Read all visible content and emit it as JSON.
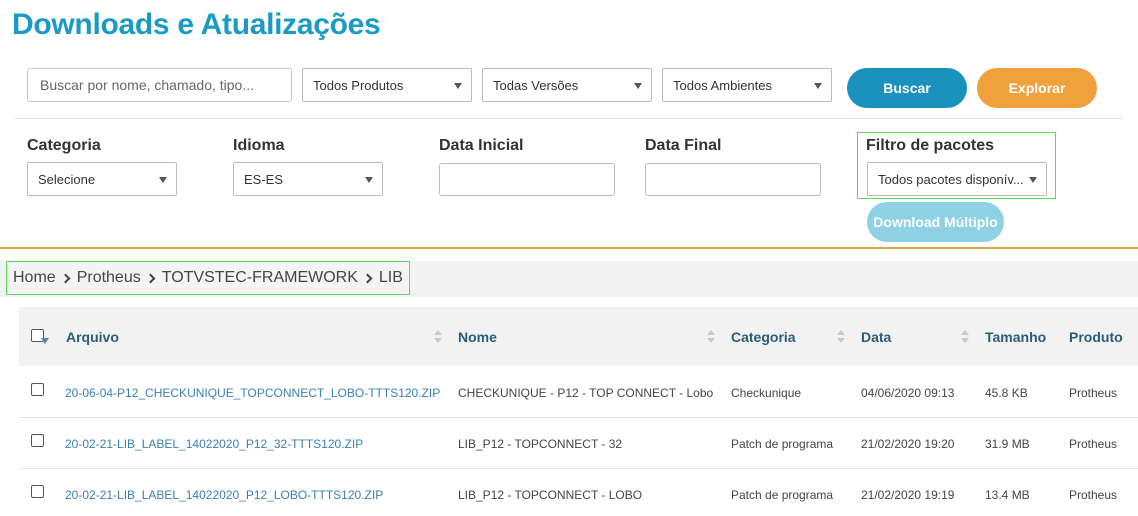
{
  "page": {
    "title": "Downloads e Atualizações"
  },
  "search": {
    "placeholder": "Buscar por nome, chamado, tipo..."
  },
  "filters": {
    "produto": "Todos Produtos",
    "versao": "Todas Versões",
    "ambiente": "Todos Ambientes",
    "buscar_label": "Buscar",
    "explorar_label": "Explorar",
    "categoria": {
      "label": "Categoria",
      "value": "Selecione"
    },
    "idioma": {
      "label": "Idioma",
      "value": "ES-ES"
    },
    "data_inicial": {
      "label": "Data Inicial"
    },
    "data_final": {
      "label": "Data Final"
    },
    "filtro_pacotes": {
      "label": "Filtro de pacotes",
      "value": "Todos pacotes disponív..."
    },
    "download_multiplo_label": "Download Múltiplo"
  },
  "breadcrumb": [
    "Home",
    "Protheus",
    "TOTVSTEC-FRAMEWORK",
    "LIB"
  ],
  "table": {
    "headers": {
      "arquivo": "Arquivo",
      "nome": "Nome",
      "categoria": "Categoria",
      "data": "Data",
      "tamanho": "Tamanho",
      "produto": "Produto"
    },
    "rows": [
      {
        "arquivo": "20-06-04-P12_CHECKUNIQUE_TOPCONNECT_LOBO-TTTS120.ZIP",
        "nome": "CHECKUNIQUE - P12 - TOP CONNECT - Lobo",
        "categoria": "Checkunique",
        "data": "04/06/2020 09:13",
        "tamanho": "45.8 KB",
        "produto": "Protheus"
      },
      {
        "arquivo": "20-02-21-LIB_LABEL_14022020_P12_32-TTTS120.ZIP",
        "nome": "LIB_P12 - TOPCONNECT - 32",
        "categoria": "Patch de programa",
        "data": "21/02/2020 19:20",
        "tamanho": "31.9 MB",
        "produto": "Protheus"
      },
      {
        "arquivo": "20-02-21-LIB_LABEL_14022020_P12_LOBO-TTTS120.ZIP",
        "nome": "LIB_P12 - TOPCONNECT - LOBO",
        "categoria": "Patch de programa",
        "data": "21/02/2020 19:19",
        "tamanho": "13.4 MB",
        "produto": "Protheus"
      }
    ]
  }
}
